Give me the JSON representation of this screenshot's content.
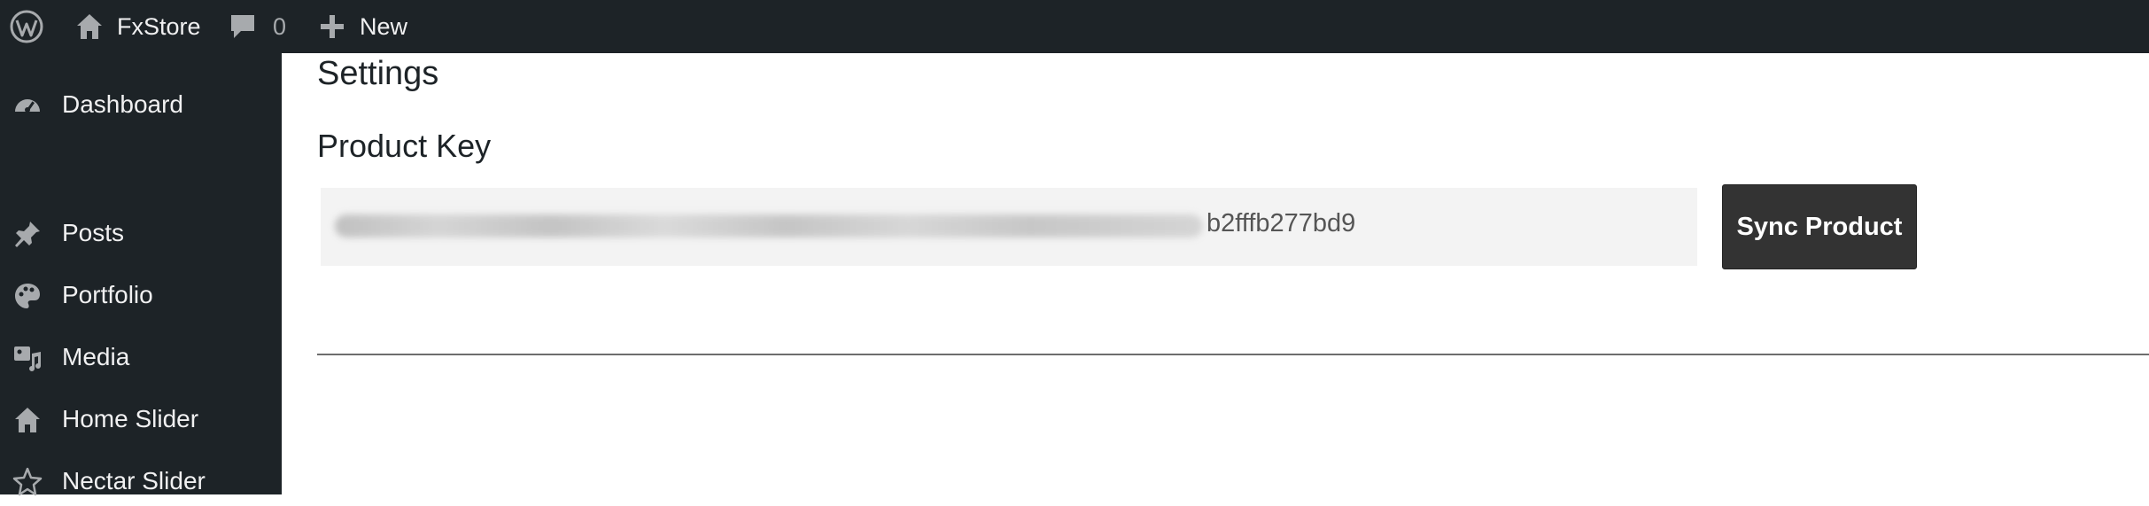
{
  "admin_bar": {
    "site_name": "FxStore",
    "comments_count": "0",
    "new_label": "New"
  },
  "sidebar": {
    "items": [
      {
        "label": "Dashboard",
        "icon": "dashboard-icon"
      },
      {
        "label": "Posts",
        "icon": "pin-icon"
      },
      {
        "label": "Portfolio",
        "icon": "palette-icon"
      },
      {
        "label": "Media",
        "icon": "media-icon"
      },
      {
        "label": "Home Slider",
        "icon": "home-icon"
      },
      {
        "label": "Nectar Slider",
        "icon": "star-icon"
      }
    ]
  },
  "main": {
    "title": "Settings",
    "product_key_label": "Product Key",
    "product_key_visible_suffix": "b2fffb277bd9",
    "sync_button_label": "Sync Product"
  }
}
